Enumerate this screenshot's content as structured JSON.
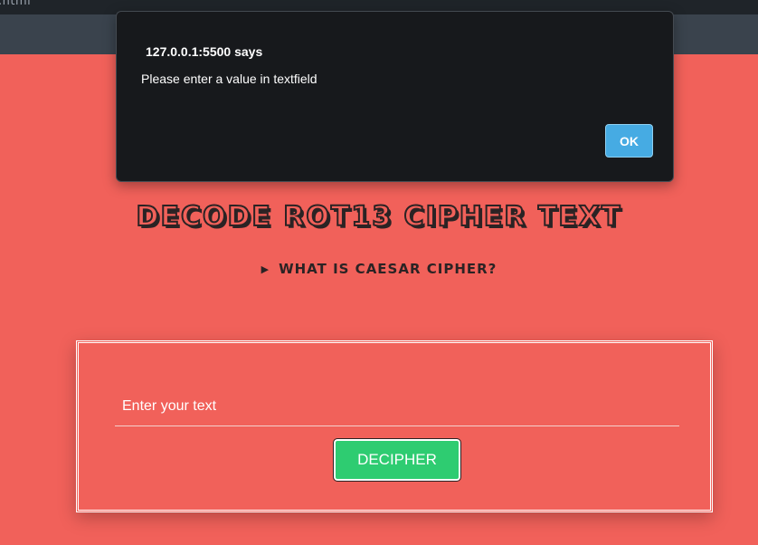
{
  "browser": {
    "tab_fragment": ".html"
  },
  "page": {
    "title": "Decode ROT13 Cipher Text",
    "details_summary": "What is caesar cipher?",
    "input_placeholder": "Enter your text",
    "input_value": "",
    "decipher_label": "DECIPHER"
  },
  "alert": {
    "title": "127.0.0.1:5500 says",
    "message": "Please enter a value in textfield",
    "ok_label": "OK"
  },
  "colors": {
    "page_background": "#f1615a",
    "button_green": "#2ecc71",
    "alert_background": "#17191c",
    "ok_button_blue": "#46abe3"
  }
}
